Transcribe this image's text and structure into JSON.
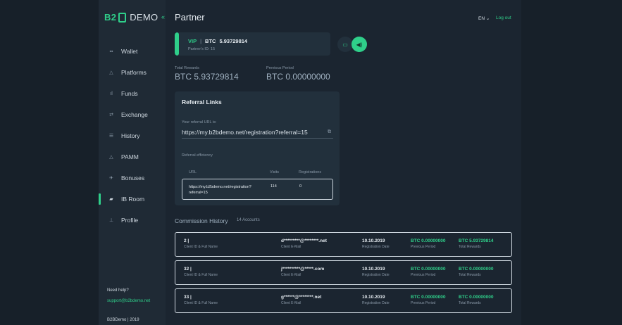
{
  "sidebar": {
    "logo": {
      "b2": "B2",
      "demo": "DEMO"
    },
    "items": [
      {
        "icon": "grid-icon",
        "glyph": "▪▪",
        "label": "Wallet"
      },
      {
        "icon": "platforms-icon",
        "glyph": "△",
        "label": "Platforms"
      },
      {
        "icon": "funds-icon",
        "glyph": "ıl",
        "label": "Funds"
      },
      {
        "icon": "exchange-icon",
        "glyph": "⇄",
        "label": "Exchange"
      },
      {
        "icon": "history-icon",
        "glyph": "☰",
        "label": "History"
      },
      {
        "icon": "pamm-icon",
        "glyph": "△",
        "label": "PAMM"
      },
      {
        "icon": "bonuses-icon",
        "glyph": "✈",
        "label": "Bonuses"
      },
      {
        "icon": "ib-room-icon",
        "glyph": "▰",
        "label": "IB Room"
      },
      {
        "icon": "profile-icon",
        "glyph": "⊥",
        "label": "Profile"
      }
    ],
    "active_index": 7,
    "help_label": "Need help?",
    "help_email": "support@b2bdemo.net",
    "copyright": "B2BDemo | 2019"
  },
  "header": {
    "title": "Partner",
    "lang": "EN ⌄",
    "logout": "Log out"
  },
  "partner": {
    "level": "VIP",
    "currency": "BTC",
    "amount": "5.93729814",
    "partner_id": "Partner's ID: 15"
  },
  "stats": {
    "total_label": "Total Rewards",
    "total_value": "BTC 5.93729814",
    "prev_label": "Previous Period",
    "prev_value": "BTC 0.00000000"
  },
  "referral": {
    "title": "Referral Links",
    "url_label": "Your referral URL is:",
    "url_value": "https://my.b2bdemo.net/registration?referral=15",
    "efficiency_label": "Referral efficiency",
    "columns": [
      "URL",
      "Visits",
      "Registrations"
    ],
    "row": {
      "url": "https://my.b2bdemo.net/registration?referral=15",
      "visits": "114",
      "registrations": "0"
    }
  },
  "commission": {
    "title": "Commission History",
    "count": "14 Accounts",
    "labels": {
      "client": "Client ID & Full Name",
      "email": "Client E-Mail",
      "date": "Registration Date",
      "prev": "Previous Period",
      "total": "Total Rewards"
    },
    "rows": [
      {
        "client": "2 |",
        "email": "d*********@********.net",
        "date": "10.10.2019",
        "prev": "BTC 0.00000000",
        "total": "BTC 5.93729814"
      },
      {
        "client": "32 |",
        "email": "j**********@*****.com",
        "date": "10.10.2019",
        "prev": "BTC 0.00000000",
        "total": "BTC 0.00000000"
      },
      {
        "client": "33 |",
        "email": "g******@********.net",
        "date": "10.10.2019",
        "prev": "BTC 0.00000000",
        "total": "BTC 0.00000000"
      }
    ]
  }
}
